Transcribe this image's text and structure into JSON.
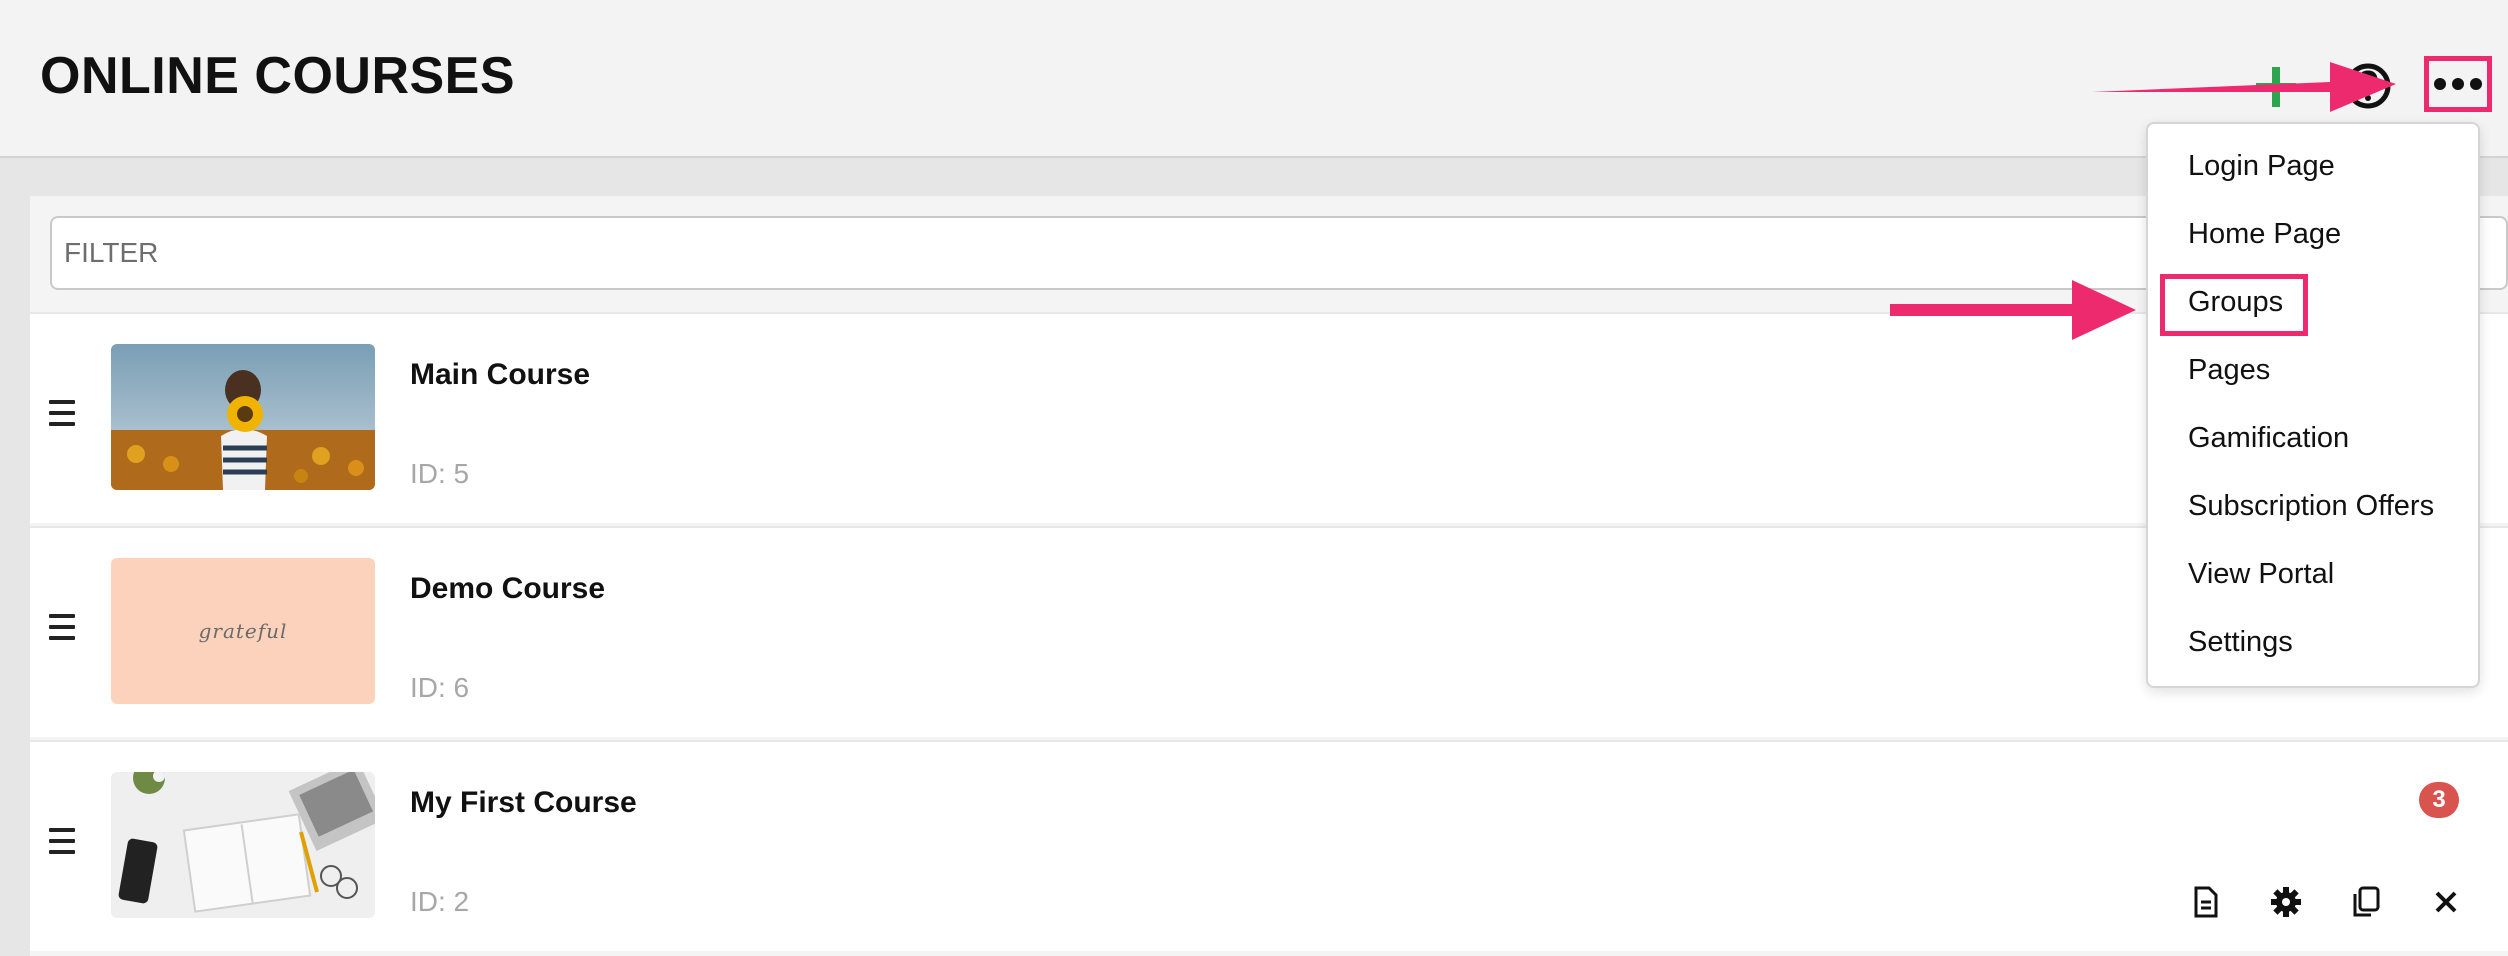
{
  "header": {
    "title": "ONLINE COURSES",
    "icons": [
      "plus-icon",
      "help-icon",
      "more-icon"
    ],
    "add_color": "#2ea44f",
    "highlight_color": "#ee2a6f"
  },
  "filter": {
    "placeholder": "FILTER",
    "value": ""
  },
  "courses": [
    {
      "title": "Main Course",
      "id_text": "ID: 5",
      "thumbnail": "sunflower-photo"
    },
    {
      "title": "Demo Course",
      "id_text": "ID: 6",
      "thumbnail": "grateful-card",
      "thumbnail_text": "grateful"
    },
    {
      "title": "My First Course",
      "id_text": "ID: 2",
      "thumbnail": "desk-photo",
      "badge": "3",
      "actions": [
        "document-icon",
        "gear-icon",
        "copy-icon",
        "close-icon"
      ]
    }
  ],
  "menu": {
    "items": [
      "Login Page",
      "Home Page",
      "Groups",
      "Pages",
      "Gamification",
      "Subscription Offers",
      "View Portal",
      "Settings"
    ],
    "highlighted": "Groups"
  },
  "badge_color": "#d9534f"
}
